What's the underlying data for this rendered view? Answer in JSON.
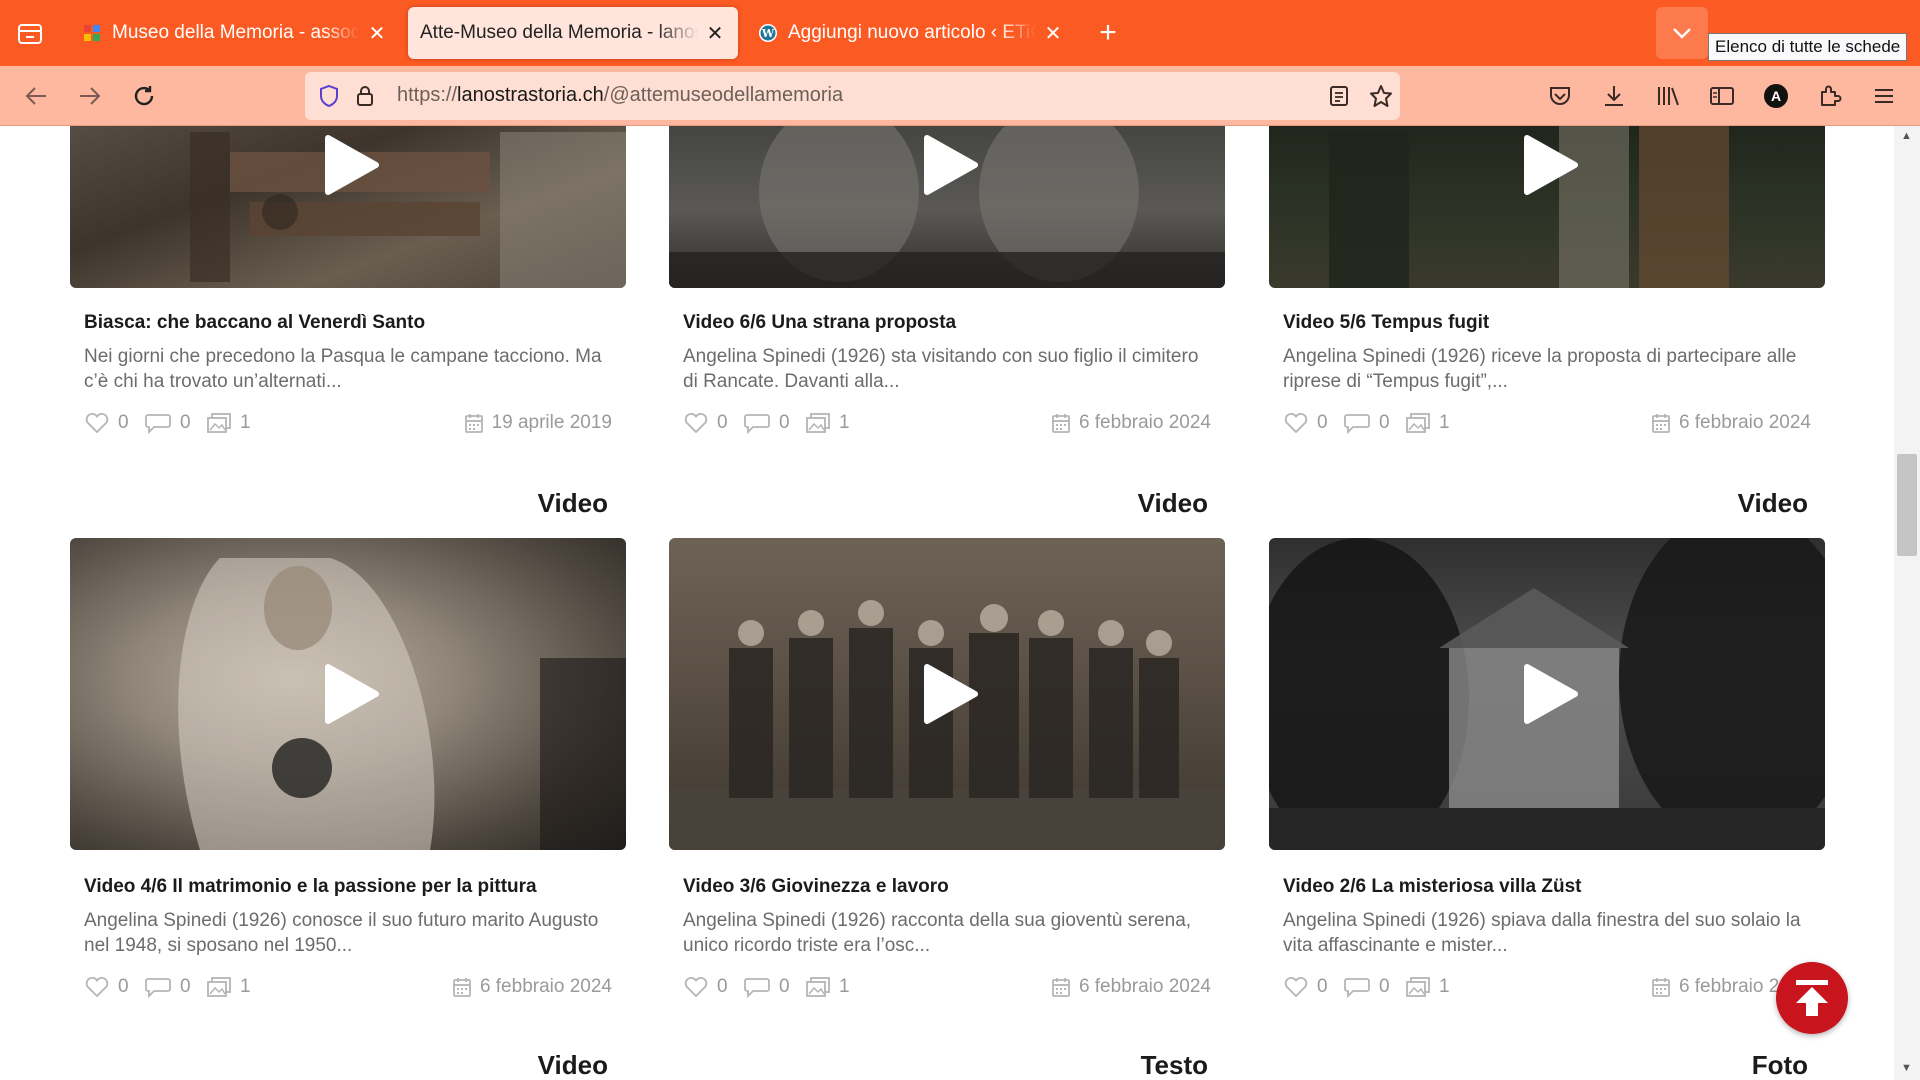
{
  "browser": {
    "tabs": [
      {
        "title": "Museo della Memoria - associaz",
        "favicon": "google-colored-icon"
      },
      {
        "title": "Atte-Museo della Memoria - lanostr",
        "favicon": "none",
        "active": true
      },
      {
        "title": "Aggiungi nuovo articolo ‹ ETiCi",
        "favicon": "wordpress-icon"
      }
    ],
    "tooltip": "Elenco di tutte le schede",
    "url_prefix": "https://",
    "url_host": "lanostrastoria.ch",
    "url_path": "/@attemuseodellamemoria",
    "accent_color": "#fc5a23"
  },
  "posts": [
    {
      "title": "Biasca: che baccano al Venerdì Santo",
      "desc": "Nei giorni che precedono la Pasqua le campane tacciono. Ma c’è chi ha trovato un’alternati...",
      "likes": "0",
      "comments": "0",
      "media": "1",
      "date": "19 aprile 2019"
    },
    {
      "title": "Video 6/6 Una strana proposta",
      "desc": "Angelina Spinedi (1926) sta visitando con suo figlio il cimitero di Rancate. Davanti alla...",
      "likes": "0",
      "comments": "0",
      "media": "1",
      "date": "6 febbraio 2024"
    },
    {
      "title": "Video 5/6 Tempus fugit",
      "desc": "Angelina Spinedi (1926) riceve la proposta di partecipare alle riprese di “Tempus fugit”,...",
      "likes": "0",
      "comments": "0",
      "media": "1",
      "date": "6 febbraio 2024"
    },
    {
      "category": "Video",
      "title": "Video 4/6 Il matrimonio e la passione per la pittura",
      "desc": "Angelina Spinedi (1926) conosce il suo futuro marito Augusto nel 1948, si sposano nel 1950...",
      "likes": "0",
      "comments": "0",
      "media": "1",
      "date": "6 febbraio 2024"
    },
    {
      "category": "Video",
      "title": "Video 3/6 Giovinezza e lavoro",
      "desc": "Angelina Spinedi (1926) racconta della sua gioventù serena, unico ricordo triste era l’osc...",
      "likes": "0",
      "comments": "0",
      "media": "1",
      "date": "6 febbraio 2024"
    },
    {
      "category": "Video",
      "title": "Video 2/6 La misteriosa villa Züst",
      "desc": "Angelina Spinedi (1926) spiava dalla finestra del suo solaio la vita affascinante e mister...",
      "likes": "0",
      "comments": "0",
      "media": "1",
      "date": "6 febbraio 2024"
    }
  ],
  "next_categories": [
    "Video",
    "Testo",
    "Foto"
  ]
}
